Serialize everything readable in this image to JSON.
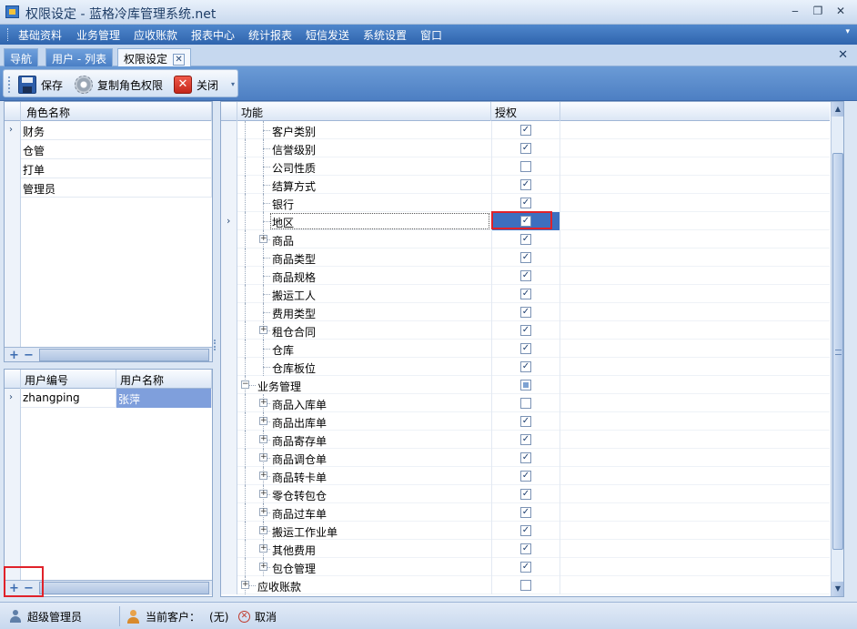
{
  "window": {
    "title": "权限设定 - 蓝格冷库管理系统.net",
    "min_label": "‒",
    "max_label": "❐",
    "close_label": "✕"
  },
  "menu": {
    "items": [
      "基础资料",
      "业务管理",
      "应收账款",
      "报表中心",
      "统计报表",
      "短信发送",
      "系统设置",
      "窗口"
    ]
  },
  "tabs": [
    {
      "label": "导航"
    },
    {
      "label": "用户 - 列表"
    },
    {
      "label": "权限设定",
      "active": true
    }
  ],
  "tab_close_label": "✕",
  "panel_close_label": "✕",
  "toolbar": {
    "save_label": "保存",
    "copy_label": "复制角色权限",
    "close_label": "关闭",
    "close_glyph": "✕",
    "more_glyph": "▾"
  },
  "roles_grid": {
    "header": "角色名称",
    "rows": [
      "财务",
      "仓管",
      "打单",
      "管理员"
    ],
    "selected_index": 0
  },
  "users_grid": {
    "headers": [
      "用户编号",
      "用户名称"
    ],
    "rows": [
      {
        "id": "zhangping",
        "name": "张萍"
      }
    ]
  },
  "grid_footer": {
    "add": "+",
    "remove": "−",
    "left_arrow": "◂",
    "right_arrow": "▸"
  },
  "tree": {
    "headers": {
      "function": "功能",
      "auth": "授权"
    },
    "check_glyph": "✓",
    "expand_glyph": "+",
    "collapse_glyph": "−",
    "row_marker": "›",
    "rows": [
      {
        "label": "客户类别",
        "level": 2,
        "state": "checked",
        "expander": "none"
      },
      {
        "label": "信誉级别",
        "level": 2,
        "state": "checked",
        "expander": "none"
      },
      {
        "label": "公司性质",
        "level": 2,
        "state": "unchecked",
        "expander": "none"
      },
      {
        "label": "结算方式",
        "level": 2,
        "state": "checked",
        "expander": "none"
      },
      {
        "label": "银行",
        "level": 2,
        "state": "checked",
        "expander": "none"
      },
      {
        "label": "地区",
        "level": 2,
        "state": "checked",
        "expander": "none",
        "selected": true
      },
      {
        "label": "商品",
        "level": 2,
        "state": "checked",
        "expander": "plus"
      },
      {
        "label": "商品类型",
        "level": 2,
        "state": "checked",
        "expander": "none"
      },
      {
        "label": "商品规格",
        "level": 2,
        "state": "checked",
        "expander": "none"
      },
      {
        "label": "搬运工人",
        "level": 2,
        "state": "checked",
        "expander": "none"
      },
      {
        "label": "费用类型",
        "level": 2,
        "state": "checked",
        "expander": "none"
      },
      {
        "label": "租仓合同",
        "level": 2,
        "state": "checked",
        "expander": "plus"
      },
      {
        "label": "仓库",
        "level": 2,
        "state": "checked",
        "expander": "none"
      },
      {
        "label": "仓库板位",
        "level": 2,
        "state": "checked",
        "expander": "none"
      },
      {
        "label": "业务管理",
        "level": 1,
        "state": "indeterminate",
        "expander": "minus"
      },
      {
        "label": "商品入库单",
        "level": 2,
        "state": "unchecked",
        "expander": "plus"
      },
      {
        "label": "商品出库单",
        "level": 2,
        "state": "checked",
        "expander": "plus"
      },
      {
        "label": "商品寄存单",
        "level": 2,
        "state": "checked",
        "expander": "plus"
      },
      {
        "label": "商品调仓单",
        "level": 2,
        "state": "checked",
        "expander": "plus"
      },
      {
        "label": "商品转卡单",
        "level": 2,
        "state": "checked",
        "expander": "plus"
      },
      {
        "label": "零仓转包仓",
        "level": 2,
        "state": "checked",
        "expander": "plus"
      },
      {
        "label": "商品过车单",
        "level": 2,
        "state": "checked",
        "expander": "plus"
      },
      {
        "label": "搬运工作业单",
        "level": 2,
        "state": "checked",
        "expander": "plus"
      },
      {
        "label": "其他费用",
        "level": 2,
        "state": "checked",
        "expander": "plus"
      },
      {
        "label": "包仓管理",
        "level": 2,
        "state": "checked",
        "expander": "plus"
      },
      {
        "label": "应收账款",
        "level": 1,
        "state": "unchecked",
        "expander": "plus"
      }
    ]
  },
  "scrollbar": {
    "up": "▲",
    "down": "▼"
  },
  "status": {
    "user": "超级管理员",
    "customer_label": "当前客户：",
    "customer_value": "(无)",
    "cancel_glyph": "✕",
    "cancel": "取消"
  },
  "highlight_color": "#e0222a",
  "selection_color": "#3d6fbf"
}
